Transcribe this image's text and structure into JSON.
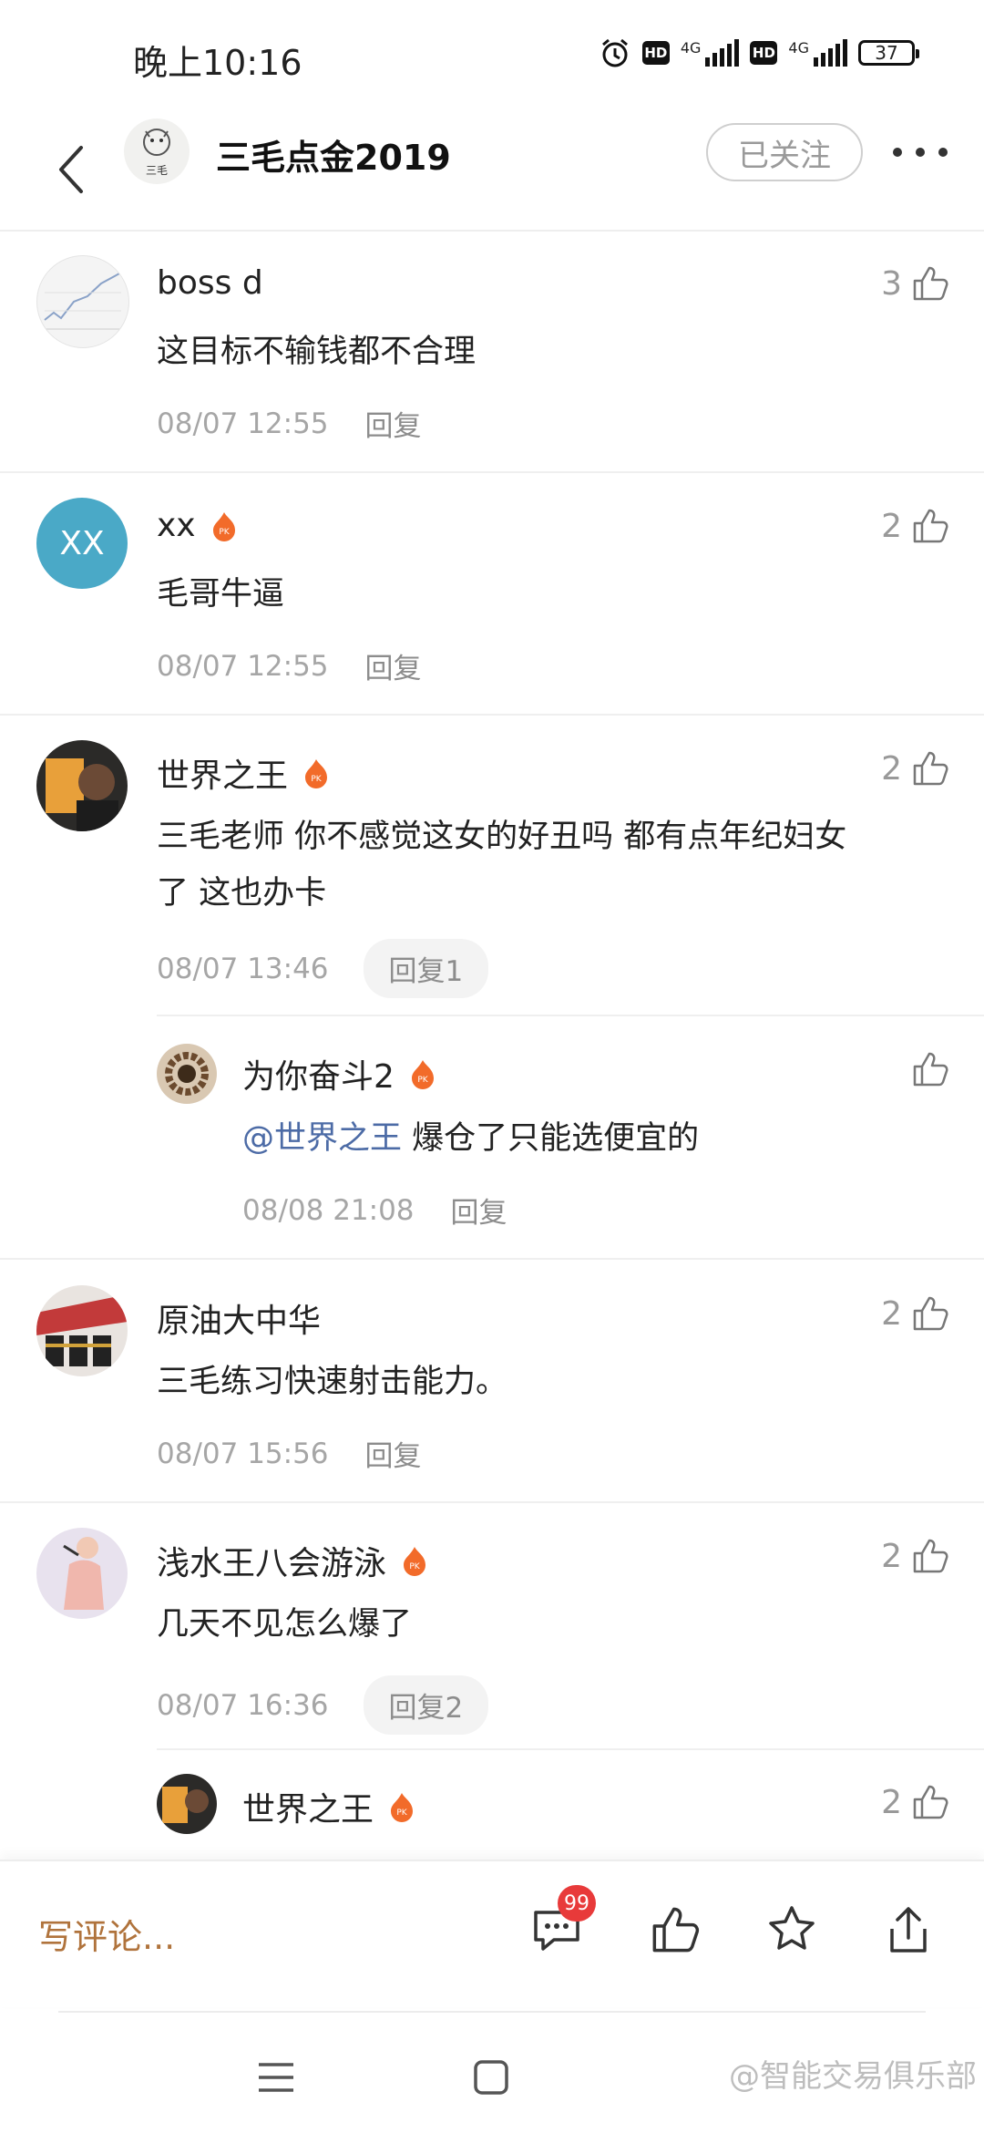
{
  "status_bar": {
    "time": "晚上10:16",
    "network1": "4G",
    "network2": "4G",
    "battery": "37"
  },
  "header": {
    "title": "三毛点金2019",
    "avatar_text": "三毛",
    "follow_label": "已关注"
  },
  "comments": [
    {
      "name": "boss d",
      "text": "这目标不输钱都不合理",
      "time": "08/07 12:55",
      "reply": "回复",
      "likes": "3"
    },
    {
      "name": "xx",
      "avatar_text": "XX",
      "text": "毛哥牛逼",
      "time": "08/07 12:55",
      "reply": "回复",
      "likes": "2"
    },
    {
      "name": "世界之王",
      "text_line1": "三毛老师 你不感觉这女的好丑吗 都有点年纪妇女",
      "text_line2": "了 这也办卡",
      "time": "08/07 13:46",
      "reply": "回复1",
      "likes": "2"
    },
    {
      "name": "为你奋斗2",
      "mention": "@世界之王",
      "text": " 爆仓了只能选便宜的",
      "time": "08/08 21:08",
      "reply": "回复"
    },
    {
      "name": "原油大中华",
      "text": "三毛练习快速射击能力。",
      "time": "08/07 15:56",
      "reply": "回复",
      "likes": "2"
    },
    {
      "name": "浅水王八会游泳",
      "text": "几天不见怎么爆了",
      "time": "08/07 16:36",
      "reply": "回复2",
      "likes": "2"
    },
    {
      "name": "世界之王",
      "likes": "2"
    }
  ],
  "bottom_bar": {
    "write_placeholder": "写评论...",
    "comment_count": "99"
  },
  "watermark": "@智能交易俱乐部",
  "colors": {
    "accent_brown": "#b0733c",
    "mention_blue": "#4c6ba6",
    "badge_red": "#e83a3a",
    "pk_orange": "#f26b2a"
  }
}
